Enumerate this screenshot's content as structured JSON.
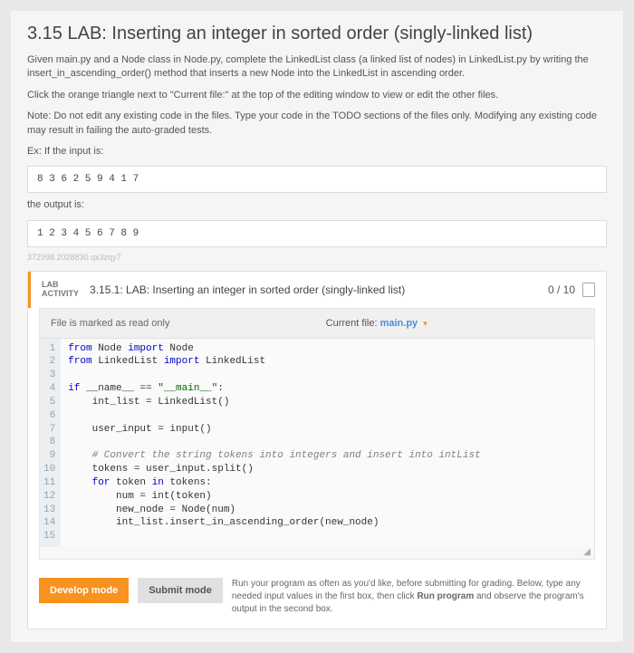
{
  "title": "3.15 LAB: Inserting an integer in sorted order (singly-linked list)",
  "para1": "Given main.py and a Node class in Node.py, complete the LinkedList class (a linked list of nodes) in LinkedList.py by writing the insert_in_ascending_order() method that inserts a new Node into the LinkedList in ascending order.",
  "para2": "Click the orange triangle next to \"Current file:\" at the top of the editing window to view or edit the other files.",
  "para3": "Note: Do not edit any existing code in the files. Type your code in the TODO sections of the files only. Modifying any existing code may result in failing the auto-graded tests.",
  "ex_label": "Ex: If the input is:",
  "input_example": "8 3 6 2 5 9 4 1 7",
  "output_label": "the output is:",
  "output_example": "1 2 3 4 5 6 7 8 9",
  "footer_code": "372998.2028830.qx3zqy7",
  "lab_badge_line1": "LAB",
  "lab_badge_line2": "ACTIVITY",
  "activity_title": "3.15.1: LAB: Inserting an integer in sorted order (singly-linked list)",
  "score": "0 / 10",
  "readonly_text": "File is marked as read only",
  "current_file_label": "Current file:",
  "current_file_name": "main.py",
  "gutter_lines": [
    "1",
    "2",
    "3",
    "4",
    "5",
    "6",
    "7",
    "8",
    "9",
    "10",
    "11",
    "12",
    "13",
    "14",
    "15"
  ],
  "code": {
    "l1a": "from",
    "l1b": " Node ",
    "l1c": "import",
    "l1d": " Node",
    "l2a": "from",
    "l2b": " LinkedList ",
    "l2c": "import",
    "l2d": " LinkedList",
    "l4a": "if",
    "l4b": " __name__ == ",
    "l4c": "\"__main__\"",
    "l4d": ":",
    "l5": "    int_list = LinkedList()",
    "l7": "    user_input = input()",
    "l9": "    # Convert the string tokens into integers and insert into intList",
    "l10": "    tokens = user_input.split()",
    "l11a": "    ",
    "l11b": "for",
    "l11c": " token ",
    "l11d": "in",
    "l11e": " tokens:",
    "l12": "        num = int(token)",
    "l13": "        new_node = Node(num)",
    "l14": "        int_list.insert_in_ascending_order(new_node)"
  },
  "develop_label": "Develop mode",
  "submit_label": "Submit mode",
  "mode_desc_a": "Run your program as often as you'd like, before submitting for grading. Below, type any needed input values in the first box, then click ",
  "mode_desc_b": "Run program",
  "mode_desc_c": " and observe the program's output in the second box."
}
